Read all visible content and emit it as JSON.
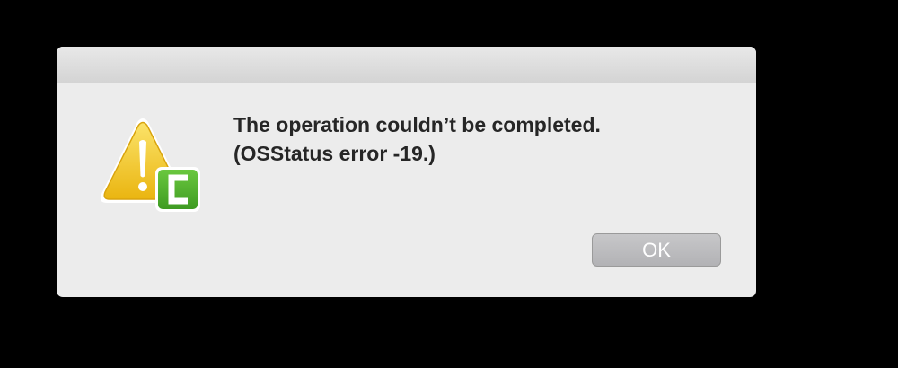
{
  "dialog": {
    "message_line1": "The operation couldn’t be completed.",
    "message_line2": "(OSStatus error -19.)",
    "ok_label": "OK",
    "icons": {
      "warning": "warning-triangle-icon",
      "app_badge": "camtasia-app-icon"
    }
  },
  "colors": {
    "window_background": "#ececec",
    "button_fill": "#b8b8bb",
    "warning_yellow": "#f1c31a",
    "badge_green": "#4caf2a"
  }
}
